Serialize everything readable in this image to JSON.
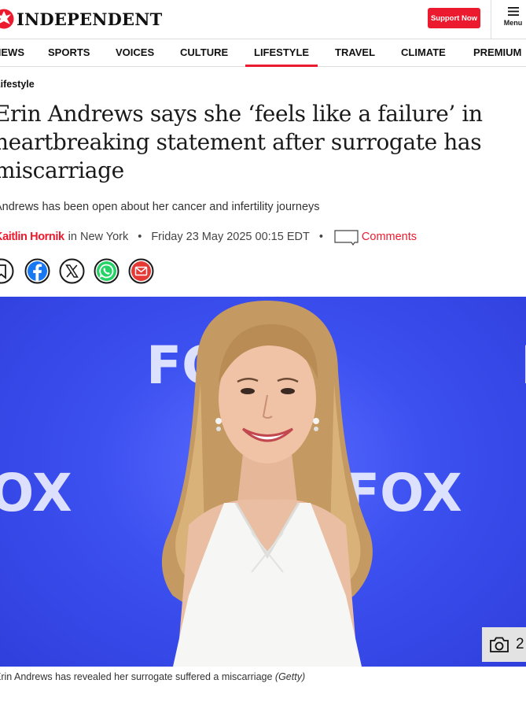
{
  "header": {
    "logo_text": "INDEPENDENT",
    "support_label": "Support Now",
    "menu_label": "Menu",
    "accent_color": "#ec1a2e"
  },
  "nav": {
    "items": [
      {
        "label": "NEWS"
      },
      {
        "label": "SPORTS"
      },
      {
        "label": "VOICES"
      },
      {
        "label": "CULTURE"
      },
      {
        "label": "LIFESTYLE",
        "active": true
      },
      {
        "label": "TRAVEL"
      },
      {
        "label": "CLIMATE"
      },
      {
        "label": "PREMIUM"
      }
    ]
  },
  "article": {
    "section": "Lifestyle",
    "headline": "Erin Andrews says she ‘feels like a failure’ in heartbreaking statement after surrogate has miscarriage",
    "standfirst": "Andrews has been open about her cancer and infertility journeys",
    "author": "Kaitlin Hornik",
    "location": "in New York",
    "date": "Friday 23 May 2025 00:15 EDT",
    "comments_label": "Comments",
    "share_icons": [
      "bookmark-icon",
      "facebook-icon",
      "x-icon",
      "whatsapp-icon",
      "email-icon"
    ],
    "image": {
      "backdrop_text": "FOX",
      "gallery_count": "2",
      "caption": "Erin Andrews has revealed her surrogate suffered a miscarriage",
      "credit": "(Getty)"
    }
  }
}
